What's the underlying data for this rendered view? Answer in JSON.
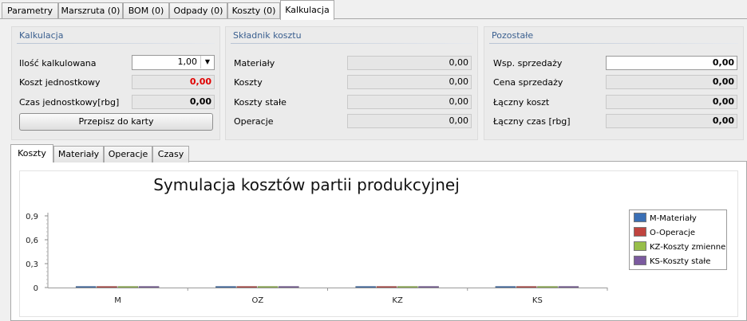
{
  "top_tabs": [
    "Parametry",
    "Marszruta (0)",
    "BOM (0)",
    "Odpady (0)",
    "Koszty (0)",
    "Kalkulacja"
  ],
  "kalkulacja": {
    "title": "Kalkulacja",
    "ilosc_label": "Ilość kalkulowana",
    "ilosc_value": "1,00",
    "koszt_label": "Koszt jednostkowy",
    "koszt_value": "0,00",
    "czas_label": "Czas jednostkowy[rbg]",
    "czas_value": "0,00",
    "button_label": "Przepisz do karty"
  },
  "skladnik": {
    "title": "Składnik kosztu",
    "rows": [
      {
        "label": "Materiały",
        "value": "0,00"
      },
      {
        "label": "Koszty",
        "value": "0,00"
      },
      {
        "label": "Koszty stałe",
        "value": "0,00"
      },
      {
        "label": "Operacje",
        "value": "0,00"
      }
    ]
  },
  "pozostale": {
    "title": "Pozostałe",
    "rows": [
      {
        "label": "Wsp. sprzedaży",
        "value": "0,00"
      },
      {
        "label": "Cena sprzedaży",
        "value": "0,00"
      },
      {
        "label": "Łączny koszt",
        "value": "0,00"
      },
      {
        "label": "Łączny czas [rbg]",
        "value": "0,00"
      }
    ]
  },
  "bottom_tabs": [
    "Koszty",
    "Materiały",
    "Operacje",
    "Czasy"
  ],
  "colors": {
    "accent_title": "#3a5f8f",
    "red_value": "#e00000"
  },
  "chart_data": {
    "type": "bar",
    "title": "Symulacja kosztów partii produkcyjnej",
    "categories": [
      "M",
      "OZ",
      "KZ",
      "KS"
    ],
    "series": [
      {
        "name": "M-Materiały",
        "values": [
          0,
          0,
          0,
          0
        ],
        "color": "#3a6fb5"
      },
      {
        "name": "O-Operacje",
        "values": [
          0,
          0,
          0,
          0
        ],
        "color": "#c0443f"
      },
      {
        "name": "KZ-Koszty zmienne",
        "values": [
          0,
          0,
          0,
          0
        ],
        "color": "#98bf4a"
      },
      {
        "name": "KS-Koszty stałe",
        "values": [
          0,
          0,
          0,
          0
        ],
        "color": "#7b5a9f"
      }
    ],
    "yticks": [
      "0",
      "0,3",
      "0,6",
      "0,9"
    ],
    "ylim": [
      0,
      0.9
    ],
    "legend": "right"
  }
}
